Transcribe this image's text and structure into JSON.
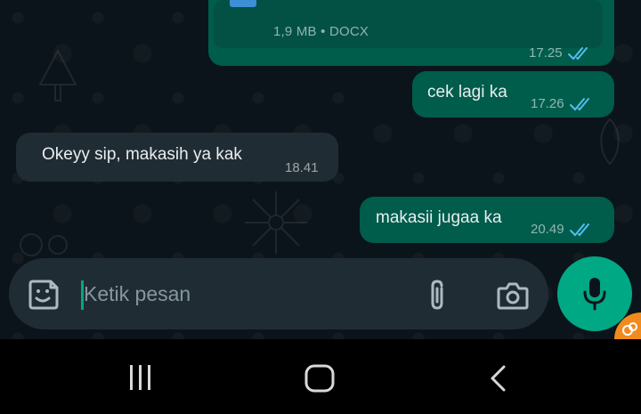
{
  "messages": [
    {
      "direction": "outgoing",
      "attachment": {
        "size": "1,9 MB",
        "type": "DOCX"
      },
      "time": "17.25",
      "status": "read"
    },
    {
      "direction": "outgoing",
      "text": "cek lagi ka",
      "time": "17.26",
      "status": "read"
    },
    {
      "direction": "incoming",
      "text": "Okeyy sip, makasih ya kak",
      "time": "18.41"
    },
    {
      "direction": "outgoing",
      "text": "makasii jugaa ka",
      "time": "20.49",
      "status": "read"
    }
  ],
  "composer": {
    "placeholder": "Ketik pesan",
    "icons": [
      "sticker-icon",
      "paperclip-icon",
      "camera-icon"
    ],
    "send_icon": "microphone-icon"
  },
  "nav": {
    "buttons": [
      "recents-icon",
      "home-icon",
      "back-icon"
    ]
  },
  "colors": {
    "background": "#0b141a",
    "outgoing_bubble": "#005c4b",
    "incoming_bubble": "#202c33",
    "accent": "#00a884",
    "read_ticks": "#53bdeb",
    "meta_text": "#8696a0"
  }
}
